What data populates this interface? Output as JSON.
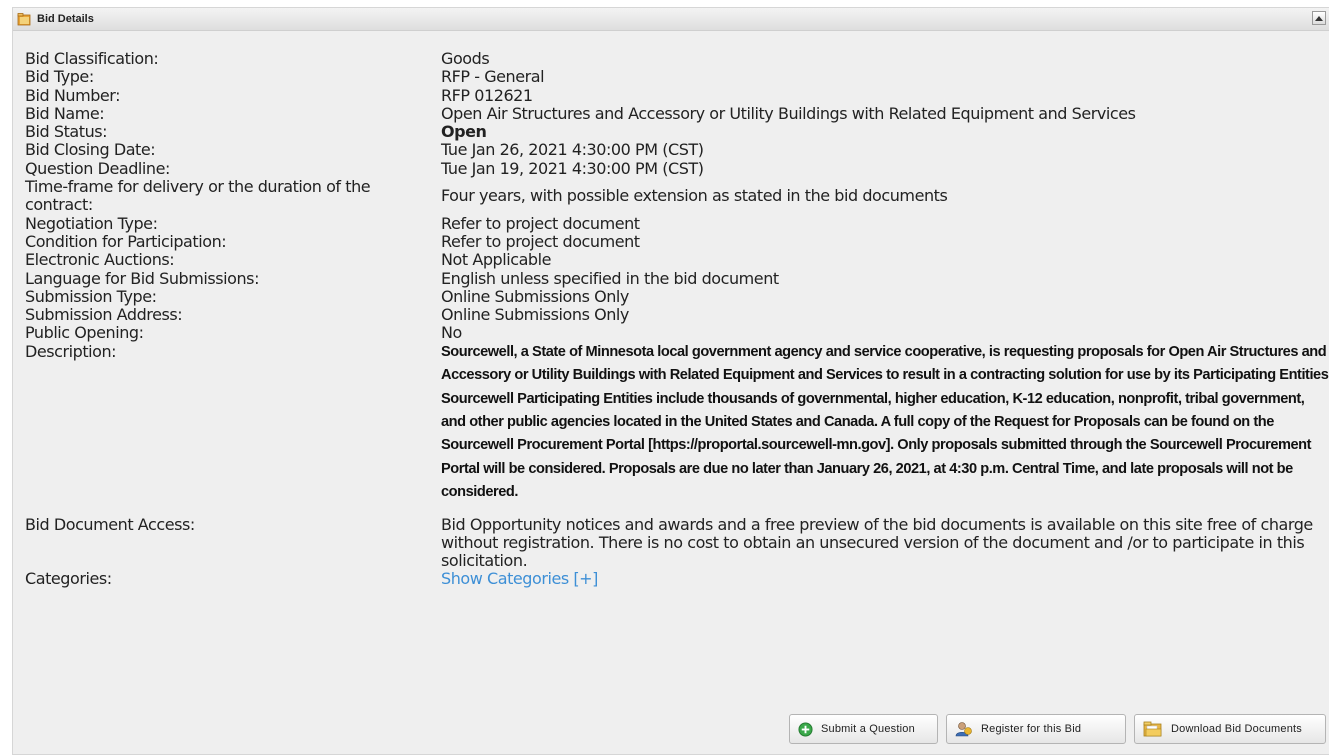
{
  "panel": {
    "title": "Bid Details",
    "folder_icon": "folder-icon",
    "collapse_icon": "chevron-up-icon"
  },
  "rows": [
    {
      "label": "Bid Classification:",
      "value": "Goods"
    },
    {
      "label": "Bid Type:",
      "value": "RFP - General"
    },
    {
      "label": "Bid Number:",
      "value": "RFP 012621"
    },
    {
      "label": "Bid Name:",
      "value": "Open Air Structures and Accessory or Utility Buildings with Related Equipment and Services"
    },
    {
      "label": "Bid Status:",
      "value": "Open"
    },
    {
      "label": "Bid Closing Date:",
      "value": "Tue Jan 26, 2021 4:30:00 PM (CST)"
    },
    {
      "label": "Question Deadline:",
      "value": "Tue Jan 19, 2021 4:30:00 PM (CST)"
    },
    {
      "label": "Time-frame for delivery or the duration of the contract:",
      "value": "Four years, with possible extension as stated in the bid documents"
    },
    {
      "label": "Negotiation Type:",
      "value": "Refer to project document"
    },
    {
      "label": "Condition for Participation:",
      "value": "Refer to project document"
    },
    {
      "label": "Electronic Auctions:",
      "value": "Not Applicable"
    },
    {
      "label": "Language for Bid Submissions:",
      "value": "English unless specified in the bid document"
    },
    {
      "label": "Submission Type:",
      "value": "Online Submissions Only"
    },
    {
      "label": "Submission Address:",
      "value": "Online Submissions Only"
    },
    {
      "label": "Public Opening:",
      "value": "No"
    },
    {
      "label": "Description:",
      "value": "Sourcewell, a State of Minnesota local government agency and service cooperative, is requesting proposals for Open Air Structures and Accessory or Utility Buildings with Related Equipment and Services to result in a contracting solution for use by its Participating Entities. Sourcewell Participating Entities include thousands of governmental, higher education, K-12 education, nonprofit, tribal government, and other public agencies located in the United States and Canada. A full copy of the Request for Proposals can be found on the Sourcewell Procurement Portal [https://proportal.sourcewell-mn.gov]. Only proposals submitted through the Sourcewell Procurement Portal will be considered. Proposals are due no later than January 26, 2021, at 4:30 p.m. Central Time, and late proposals will not be considered."
    },
    {
      "label": "Bid Document Access:",
      "value": "Bid Opportunity notices and awards and a free preview of the bid documents is available on this site free of charge without registration. There is no cost to obtain an unsecured version of the document and /or to participate in this solicitation."
    },
    {
      "label": "Categories:",
      "value": "Show Categories [+]"
    }
  ],
  "buttons": [
    {
      "label": "Submit a Question",
      "icon": "plus-circle-icon"
    },
    {
      "label": "Register for this Bid",
      "icon": "user-icon"
    },
    {
      "label": "Download Bid Documents",
      "icon": "folder-icon"
    }
  ],
  "colors": {
    "panel_bg": "#efefef",
    "link": "#3d8fd6",
    "submit_icon": "#3aa84a",
    "folder_icon": "#e8b646"
  }
}
